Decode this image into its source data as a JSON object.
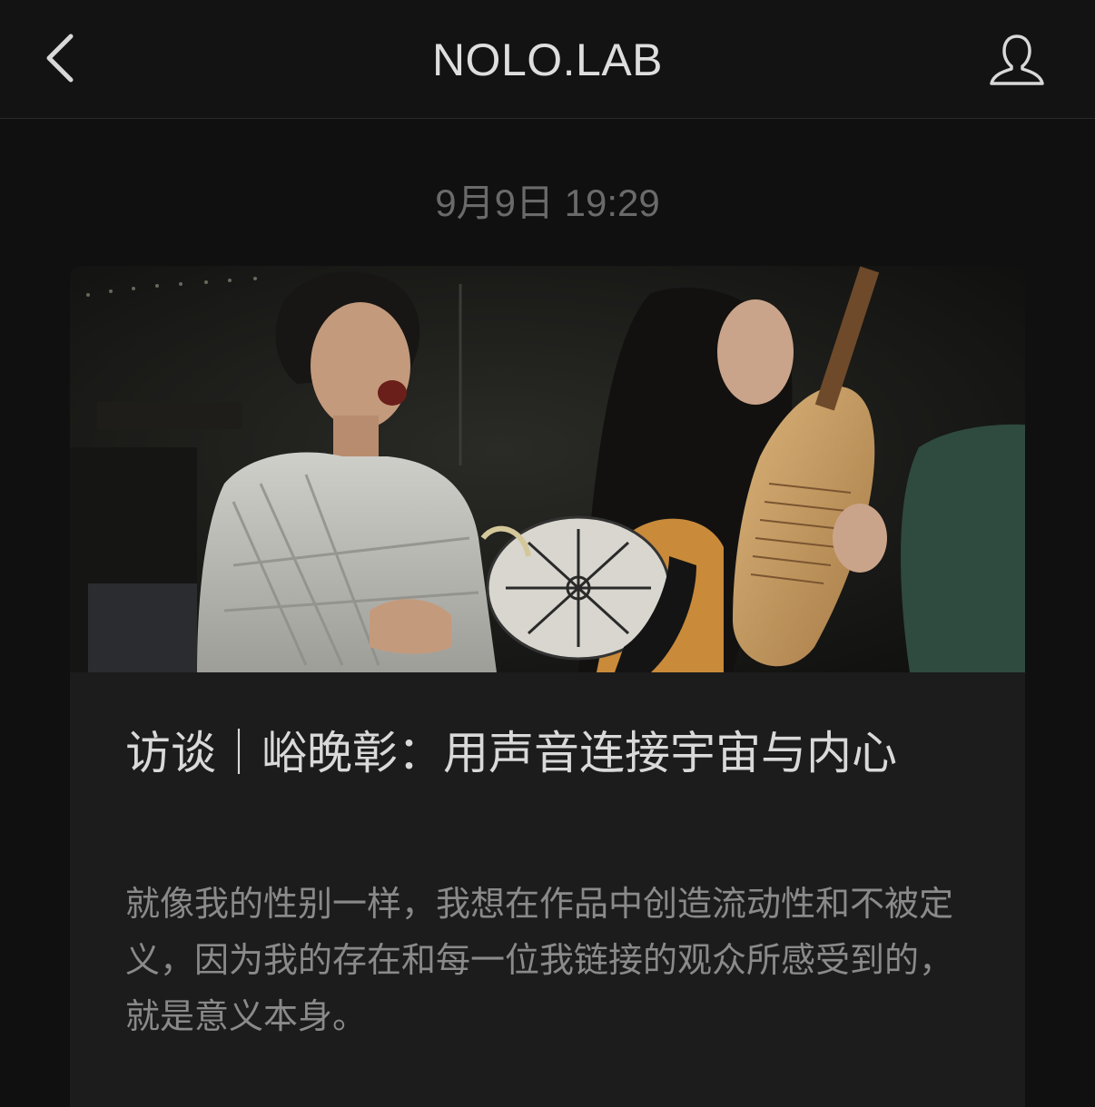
{
  "navbar": {
    "title": "NOLO.LAB",
    "back_icon": "chevron-left-icon",
    "profile_icon": "user-icon"
  },
  "message": {
    "timestamp": "9月9日 19:29"
  },
  "article": {
    "cover_description": "photo",
    "title": "访谈｜峪晚彰：用声音连接宇宙与内心",
    "summary": "就像我的性别一样，我想在作品中创造流动性和不被定义，因为我的存在和每一位我链接的观众所感受到的，就是意义本身。"
  },
  "colors": {
    "background": "#101010",
    "navbar": "#131313",
    "card": "#1c1c1c",
    "title_text": "#d9d9d9",
    "summary_text": "#8a8a8a",
    "timestamp_text": "#6a6a6a"
  }
}
